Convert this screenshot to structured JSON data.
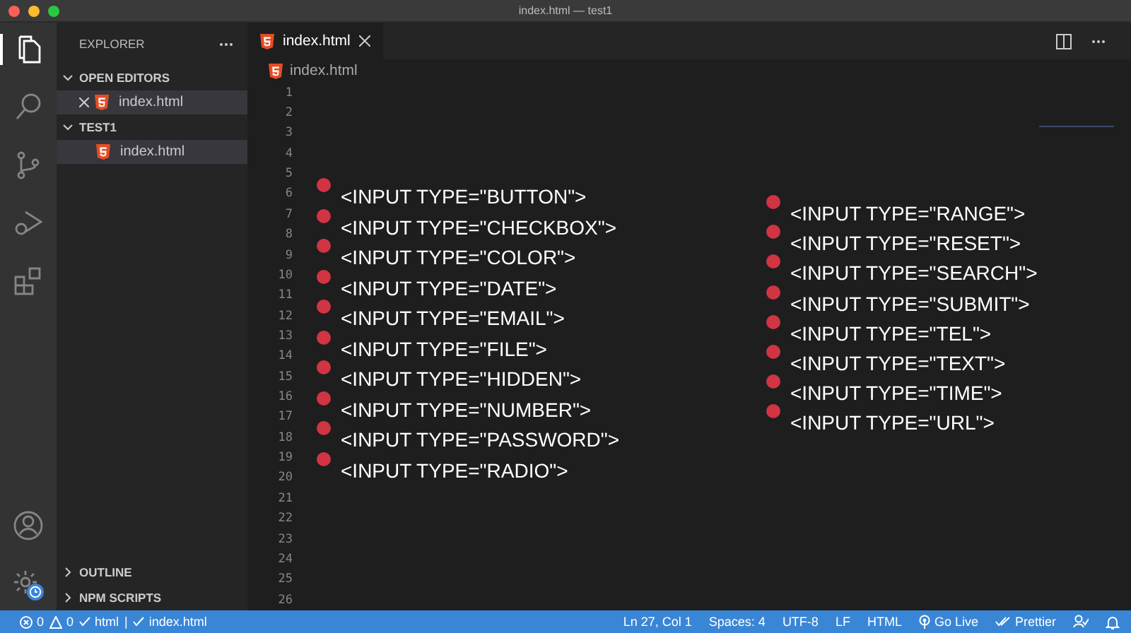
{
  "window": {
    "title": "index.html — test1"
  },
  "sidebar": {
    "title": "EXPLORER",
    "sections": [
      {
        "kind": "open-editors",
        "label": "OPEN EDITORS",
        "expanded": true,
        "files": [
          {
            "name": "index.html",
            "selected": true
          }
        ]
      },
      {
        "kind": "folder",
        "label": "TEST1",
        "expanded": true,
        "files": [
          {
            "name": "index.html",
            "selected": true
          }
        ]
      },
      {
        "kind": "panel",
        "label": "OUTLINE",
        "expanded": false
      },
      {
        "kind": "panel",
        "label": "NPM SCRIPTS",
        "expanded": false
      }
    ]
  },
  "editor": {
    "tabs": [
      {
        "label": "index.html",
        "selected": true
      }
    ],
    "breadcrumb": [
      "index.html"
    ],
    "line_numbers": [
      "1",
      "2",
      "3",
      "4",
      "5",
      "6",
      "7",
      "8",
      "9",
      "10",
      "11",
      "12",
      "13",
      "14",
      "15",
      "16",
      "17",
      "18",
      "19",
      "20",
      "21",
      "22",
      "23",
      "24",
      "25",
      "26"
    ],
    "overlay_columns": [
      [
        "<INPUT TYPE=\"BUTTON\">",
        "<INPUT TYPE=\"CHECKBOX\">",
        "<INPUT TYPE=\"COLOR\">",
        "<INPUT TYPE=\"DATE\">",
        "<INPUT TYPE=\"EMAIL\">",
        "<INPUT TYPE=\"FILE\">",
        "<INPUT TYPE=\"HIDDEN\">",
        "<INPUT TYPE=\"NUMBER\">",
        "<INPUT TYPE=\"PASSWORD\">",
        "<INPUT TYPE=\"RADIO\">"
      ],
      [
        "<INPUT TYPE=\"RANGE\">",
        "<INPUT TYPE=\"RESET\">",
        "<INPUT TYPE=\"SEARCH\">",
        "<INPUT TYPE=\"SUBMIT\">",
        "<INPUT TYPE=\"TEL\">",
        "<INPUT TYPE=\"TEXT\">",
        "<INPUT TYPE=\"TIME\">",
        "<INPUT TYPE=\"URL\">"
      ]
    ]
  },
  "status_bar": {
    "left": [
      {
        "kind": "errors",
        "text": "0"
      },
      {
        "kind": "warnings",
        "text": "0"
      },
      {
        "kind": "check",
        "text": "html"
      },
      {
        "kind": "plain",
        "text": "|"
      },
      {
        "kind": "check",
        "text": "index.html"
      }
    ],
    "right": [
      {
        "kind": "plain",
        "text": "Ln 27, Col 1"
      },
      {
        "kind": "plain",
        "text": "Spaces: 4"
      },
      {
        "kind": "plain",
        "text": "UTF-8"
      },
      {
        "kind": "plain",
        "text": "LF"
      },
      {
        "kind": "plain",
        "text": "HTML"
      },
      {
        "kind": "broadcast",
        "text": "Go Live"
      },
      {
        "kind": "double-check",
        "text": "Prettier"
      },
      {
        "kind": "feedback"
      },
      {
        "kind": "bell"
      }
    ]
  }
}
